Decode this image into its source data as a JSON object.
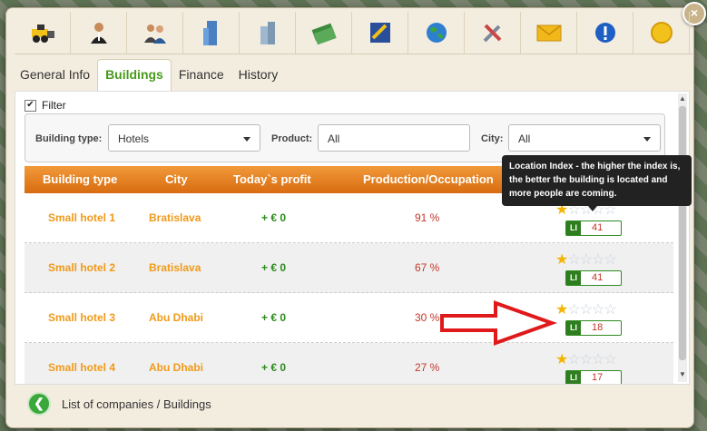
{
  "toolbar": {
    "icons": [
      "bulldozer-icon",
      "manager-icon",
      "people-icon",
      "building-icon",
      "factory-icon",
      "money-icon",
      "map-icon",
      "globe-icon",
      "tools-icon",
      "mail-icon",
      "info-alert-icon",
      "coin-icon"
    ]
  },
  "tabs": [
    {
      "label": "General Info",
      "active": false
    },
    {
      "label": "Buildings",
      "active": true
    },
    {
      "label": "Finance",
      "active": false
    },
    {
      "label": "History",
      "active": false
    }
  ],
  "filter": {
    "checkbox_label": "Filter",
    "checked": true,
    "building_type_label": "Building type:",
    "building_type_value": "Hotels",
    "product_label": "Product:",
    "product_value": "All",
    "city_label": "City:",
    "city_value": "All"
  },
  "table": {
    "headers": [
      "Building type",
      "City",
      "Today`s profit",
      "Production/Occupation"
    ],
    "rows": [
      {
        "type": "Small hotel 1",
        "city": "Bratislava",
        "profit": "+ € 0",
        "production": "91 %",
        "stars": 1,
        "li": "41"
      },
      {
        "type": "Small hotel 2",
        "city": "Bratislava",
        "profit": "+ € 0",
        "production": "67 %",
        "stars": 1,
        "li": "41"
      },
      {
        "type": "Small hotel 3",
        "city": "Abu Dhabi",
        "profit": "+ € 0",
        "production": "30 %",
        "stars": 1,
        "li": "18"
      },
      {
        "type": "Small hotel 4",
        "city": "Abu Dhabi",
        "profit": "+ € 0",
        "production": "27 %",
        "stars": 1,
        "li": "17"
      }
    ],
    "li_tag": "LI"
  },
  "tooltip": {
    "text": "Location Index - the higher the index is, the better the building is located and more people are coming."
  },
  "footer": {
    "breadcrumb": "List of companies / Buildings"
  },
  "close_label": "×",
  "colors": {
    "accent_orange": "#e07a1a",
    "accent_green": "#4a9a1d",
    "value_red": "#c0392b"
  }
}
